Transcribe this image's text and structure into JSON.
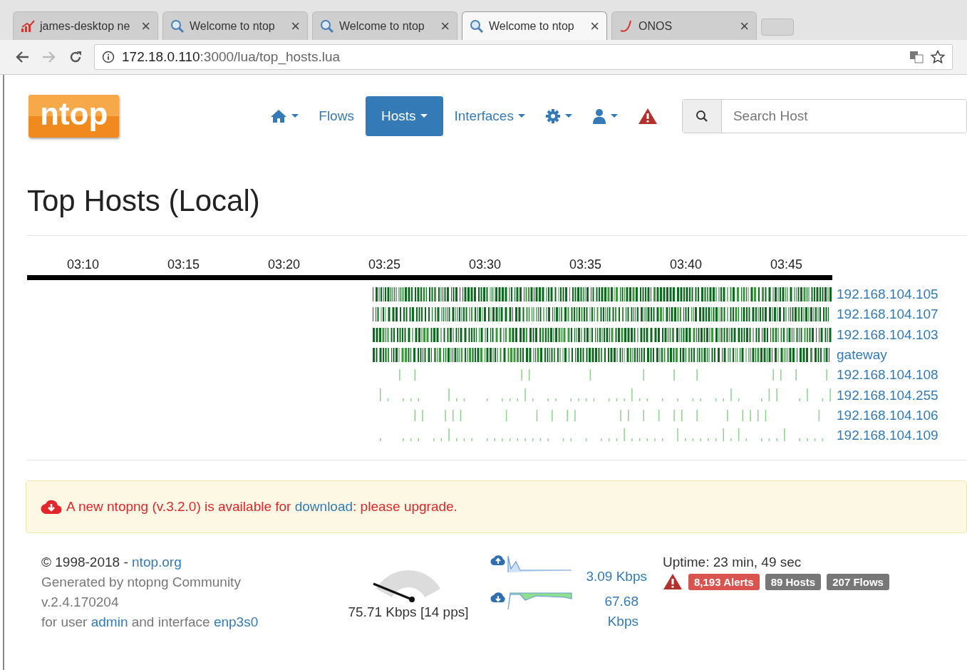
{
  "browser": {
    "tabs": [
      {
        "title": "james-desktop ne",
        "kind": "chart",
        "selected": false
      },
      {
        "title": "Welcome to ntop",
        "kind": "search",
        "selected": false
      },
      {
        "title": "Welcome to ntop",
        "kind": "search",
        "selected": false
      },
      {
        "title": "Welcome to ntop",
        "kind": "search",
        "selected": true
      },
      {
        "title": "ONOS",
        "kind": "onos",
        "selected": false
      }
    ],
    "close_glyph": "×",
    "url_host": "172.18.0.110",
    "url_path": ":3000/lua/top_hosts.lua"
  },
  "logo": "ntop",
  "nav": [
    {
      "kind": "home",
      "caret": true,
      "selected": false
    },
    {
      "kind": "text",
      "label": "Flows",
      "selected": false
    },
    {
      "kind": "text",
      "label": "Hosts",
      "caret": true,
      "selected": true
    },
    {
      "kind": "text",
      "label": "Interfaces",
      "caret": true,
      "selected": false
    },
    {
      "kind": "gear",
      "caret": true,
      "selected": false
    },
    {
      "kind": "user",
      "caret": true,
      "selected": false
    },
    {
      "kind": "alert",
      "selected": false
    }
  ],
  "search": {
    "placeholder": "Search Host"
  },
  "heading": "Top Hosts (Local)",
  "timeline": {
    "ticks": [
      "03:10",
      "03:15",
      "03:20",
      "03:25",
      "03:30",
      "03:35",
      "03:40",
      "03:45"
    ],
    "hosts": [
      {
        "name": "192.168.104.105",
        "kind": "dense"
      },
      {
        "name": "192.168.104.107",
        "kind": "dense"
      },
      {
        "name": "192.168.104.103",
        "kind": "dense"
      },
      {
        "name": "gateway",
        "kind": "dense"
      },
      {
        "name": "192.168.104.108",
        "kind": "sparse"
      },
      {
        "name": "192.168.104.255",
        "kind": "dots"
      },
      {
        "name": "192.168.104.106",
        "kind": "sparse"
      },
      {
        "name": "192.168.104.109",
        "kind": "dots"
      }
    ]
  },
  "notice": {
    "before": "A new ntopng (v.3.2.0) is available for ",
    "link": "download",
    "after": ": please upgrade."
  },
  "footer": {
    "copyright": "© 1998-2018 - ",
    "copyright_link": "ntop.org",
    "generated": "Generated by ntopng Community",
    "version": "v.2.4.170204",
    "user_prefix": "for user ",
    "user": "admin",
    "iface_prefix": " and interface ",
    "iface": "enp3s0",
    "gauge": {
      "reading": "75.71 Kbps [14 pps]"
    },
    "upload": "3.09 Kbps",
    "download": "67.68 Kbps",
    "uptime": "Uptime: 23 min, 49 sec",
    "badges": [
      {
        "text": "8,193 Alerts",
        "color": "#d9534f"
      },
      {
        "text": "89 Hosts",
        "color": "#777777"
      },
      {
        "text": "207 Flows",
        "color": "#777777"
      }
    ]
  }
}
